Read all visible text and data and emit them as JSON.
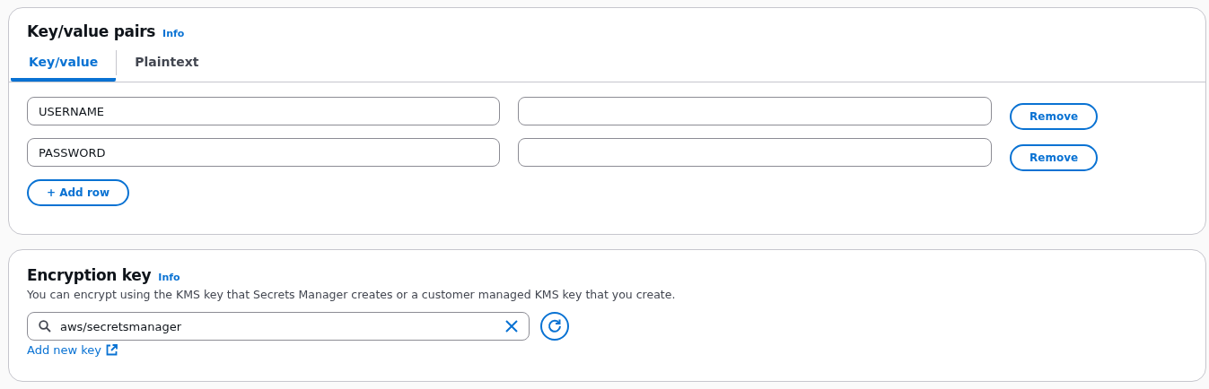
{
  "key_value_pairs": {
    "title": "Key/value pairs",
    "info_link": "Info",
    "tabs": [
      {
        "label": "Key/value",
        "selected": true
      },
      {
        "label": "Plaintext",
        "selected": false
      }
    ],
    "rows": [
      {
        "key": "USERNAME",
        "value_placeholder": "",
        "remove_label": "Remove"
      },
      {
        "key": "PASSWORD",
        "value_placeholder": "",
        "remove_label": "Remove"
      }
    ],
    "add_row_label": "+ Add row"
  },
  "encryption_key": {
    "title": "Encryption key",
    "info_link": "Info",
    "description": "You can encrypt using the KMS key that Secrets Manager creates or a customer managed KMS key that you create.",
    "search_value": "aws/secretsmanager",
    "add_new_key_link": "Add new key"
  }
}
